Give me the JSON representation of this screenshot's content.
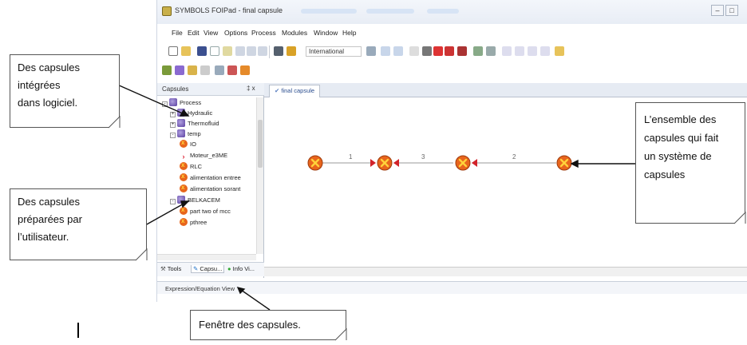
{
  "window": {
    "title": "SYMBOLS FOIPad - final capsule",
    "menu": [
      "File",
      "Edit",
      "View",
      "Options",
      "Process",
      "Modules",
      "Window",
      "Help"
    ],
    "language_combo": "International"
  },
  "capsules_pane": {
    "title": "Capsules",
    "controls": "‡ x",
    "tree": [
      {
        "label": "Process",
        "icon": "folder-group-icon",
        "level": 0,
        "expander": "-"
      },
      {
        "label": "Hydraulic",
        "icon": "folder-group-icon",
        "level": 1,
        "expander": "+"
      },
      {
        "label": "Thermofluid",
        "icon": "folder-group-icon",
        "level": 1,
        "expander": "+"
      },
      {
        "label": "temp",
        "icon": "folder-group-icon",
        "level": 1,
        "expander": "-"
      },
      {
        "label": "IO",
        "icon": "capsule-icon",
        "level": 2
      },
      {
        "label": "Moteur_e3ME",
        "icon": "motor-icon",
        "level": 2
      },
      {
        "label": "RLC",
        "icon": "capsule-icon",
        "level": 2
      },
      {
        "label": "alimentation entree",
        "icon": "capsule-icon",
        "level": 2
      },
      {
        "label": "alimentation sorant",
        "icon": "capsule-icon",
        "level": 2
      },
      {
        "label": "BELKACEM",
        "icon": "folder-group-icon",
        "level": 1,
        "expander": "-"
      },
      {
        "label": "part two of mcc",
        "icon": "capsule-icon",
        "level": 2
      },
      {
        "label": "pthree",
        "icon": "capsule-icon",
        "level": 2
      }
    ],
    "tabs": [
      "Tools",
      "Capsu...",
      "Info Vi..."
    ]
  },
  "editor": {
    "tab_label": "final capsule",
    "capsule_links": [
      "1",
      "3",
      "2"
    ]
  },
  "expression_panel": {
    "label": "Expression/Equation View"
  },
  "callouts": {
    "integrated": [
      "Des capsules",
      "intégrées",
      "dans logiciel."
    ],
    "prepared": [
      "Des capsules",
      "préparées  par",
      "l’utilisateur."
    ],
    "system": [
      "L’ensemble des",
      "capsules qui fait",
      "un système de",
      "capsules"
    ],
    "window": [
      "Fenêtre des capsules."
    ]
  },
  "colors": {
    "capsule_fill": "#e8651c",
    "capsule_mark": "#ffd23a",
    "connector": "#d2232a",
    "doc_tab_text": "#2a4d8f"
  }
}
